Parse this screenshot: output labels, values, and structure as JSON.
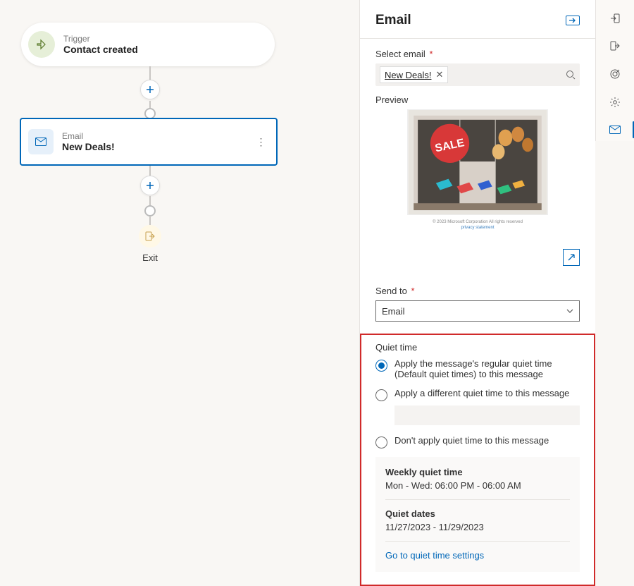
{
  "canvas": {
    "trigger": {
      "label": "Trigger",
      "title": "Contact created"
    },
    "email_node": {
      "label": "Email",
      "title": "New Deals!"
    },
    "exit": "Exit"
  },
  "panel": {
    "header": "Email",
    "select_email_label": "Select email",
    "chip_label": "New Deals!",
    "preview_label": "Preview",
    "preview_sale_text": "SALE",
    "preview_meta1": "© 2023 Microsoft Corporation All rights reserved",
    "preview_meta2": "privacy statement",
    "send_to_label": "Send to",
    "send_to_value": "Email",
    "quiet_time": {
      "title": "Quiet time",
      "opt1": "Apply the message's regular quiet time (Default quiet times) to this message",
      "opt2": "Apply a different quiet time to this message",
      "opt3": "Don't apply quiet time to this message",
      "weekly_title": "Weekly quiet time",
      "weekly_value": "Mon - Wed: 06:00 PM - 06:00 AM",
      "dates_title": "Quiet dates",
      "dates_value": "11/27/2023 - 11/29/2023",
      "link": "Go to quiet time settings"
    }
  }
}
